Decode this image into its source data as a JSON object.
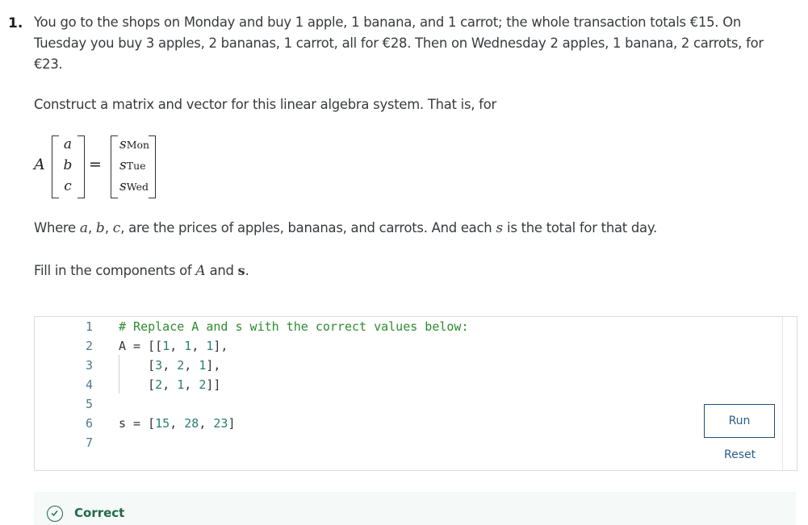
{
  "question": {
    "number": "1.",
    "intro": "You go to the shops on Monday and buy 1 apple, 1 banana, and 1 carrot; the whole transaction totals €15. On Tuesday you buy 3 apples, 2 bananas, 1 carrot, all for €28. Then on Wednesday 2 apples, 1 banana, 2 carrots, for €23.",
    "instruction": "Construct a matrix and vector for this linear algebra system. That is, for",
    "equation": {
      "matrix": "A",
      "unknowns": [
        "a",
        "b",
        "c"
      ],
      "equals": "=",
      "totals": [
        {
          "var": "s",
          "sub": "Mon"
        },
        {
          "var": "s",
          "sub": "Tue"
        },
        {
          "var": "s",
          "sub": "Wed"
        }
      ]
    },
    "where": {
      "prefix": "Where ",
      "vars": [
        "a",
        "b",
        "c"
      ],
      "middle": ", are the prices of apples, bananas, and carrots. And each ",
      "s": "s",
      "suffix": " is the total for that day."
    },
    "fill": {
      "prefix": "Fill in the components of ",
      "A": "A",
      "and": " and ",
      "s": "s",
      "suffix": "."
    }
  },
  "editor": {
    "lines": [
      {
        "n": "1",
        "comment": "# Replace A and s with the correct values below:"
      },
      {
        "n": "2",
        "prefix": "A = [[",
        "nums": [
          "1",
          "1",
          "1"
        ],
        "suffix": "],"
      },
      {
        "n": "3",
        "prefix": "    [",
        "nums": [
          "3",
          "2",
          "1"
        ],
        "suffix": "],"
      },
      {
        "n": "4",
        "prefix": "    [",
        "nums": [
          "2",
          "1",
          "2"
        ],
        "suffix": "]]"
      },
      {
        "n": "5"
      },
      {
        "n": "6",
        "prefix": "s = [",
        "nums": [
          "15",
          "28",
          "23"
        ],
        "suffix": "]"
      },
      {
        "n": "7"
      }
    ],
    "run_label": "Run",
    "reset_label": "Reset"
  },
  "feedback": {
    "status": "Correct",
    "icon": "check-circle-icon",
    "color": "#1e6b47"
  }
}
